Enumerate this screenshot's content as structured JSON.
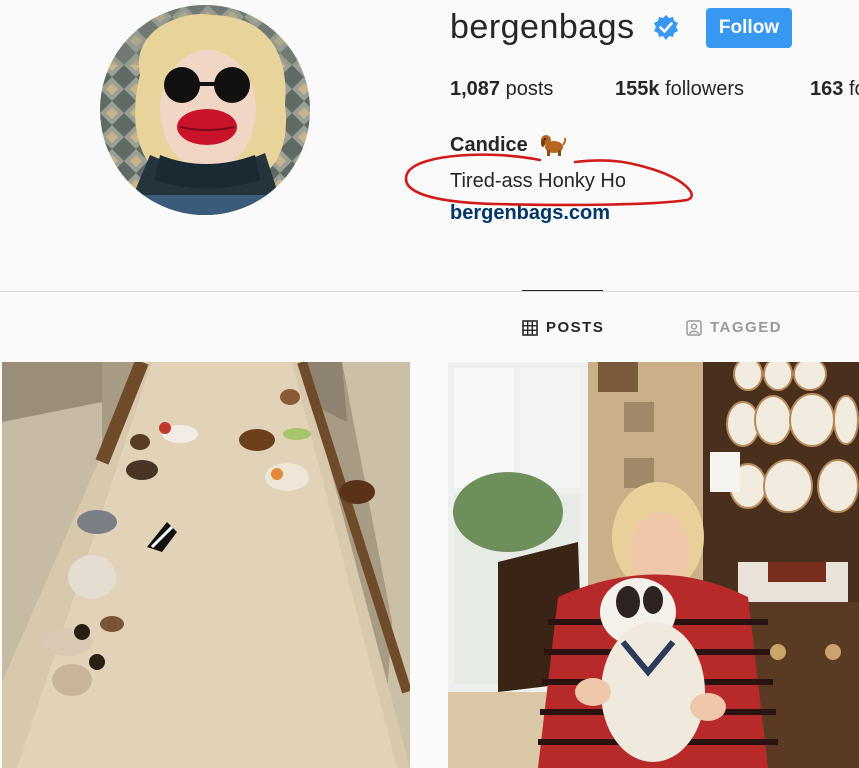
{
  "profile": {
    "username": "bergenbags",
    "follow_label": "Follow",
    "name": "Candice",
    "bio": "Tired-ass Honky Ho",
    "website": "bergenbags.com"
  },
  "stats": {
    "posts_count": "1,087",
    "posts_label": "posts",
    "followers_count": "155k",
    "followers_label": "followers",
    "following_count": "163",
    "following_label": "following"
  },
  "tabs": {
    "posts": "POSTS",
    "tagged": "TAGGED"
  },
  "icons": {
    "verified": "verified-badge-icon",
    "name_emoji": "dog-emoji-icon",
    "posts_tab": "grid-icon",
    "tagged_tab": "tagged-person-icon"
  },
  "colors": {
    "accent": "#3897f0",
    "link": "#003569",
    "annotation": "#d11a1a"
  }
}
